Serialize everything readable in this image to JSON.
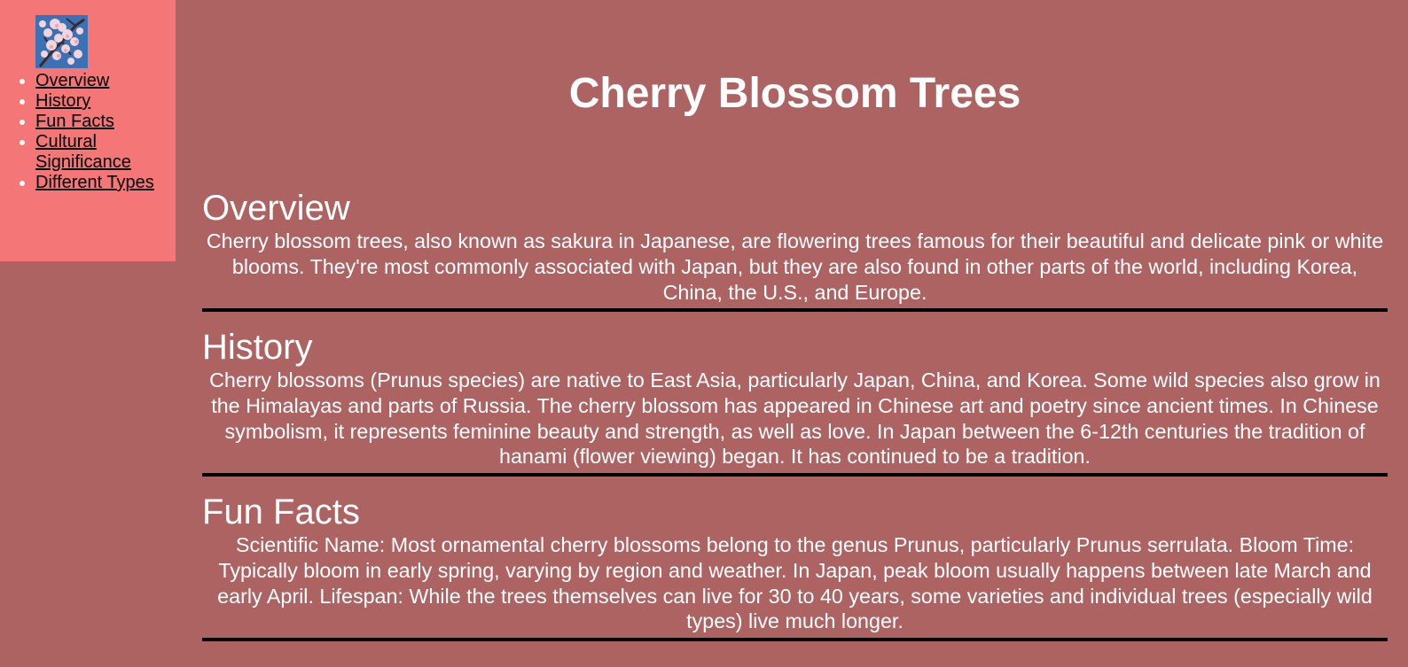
{
  "sidebar": {
    "logo_icon": "cherry-blossom-image",
    "items": [
      {
        "label": "Overview"
      },
      {
        "label": "History"
      },
      {
        "label": "Fun Facts"
      },
      {
        "label": "Cultural Significance"
      },
      {
        "label": "Different Types"
      }
    ]
  },
  "main": {
    "title": "Cherry Blossom Trees",
    "sections": [
      {
        "heading": "Overview",
        "body": "Cherry blossom trees, also known as sakura in Japanese, are flowering trees famous for their beautiful and delicate pink or white blooms. They're most commonly associated with Japan, but they are also found in other parts of the world, including Korea, China, the U.S., and Europe."
      },
      {
        "heading": "History",
        "body": "Cherry blossoms (Prunus species) are native to East Asia, particularly Japan, China, and Korea. Some wild species also grow in the Himalayas and parts of Russia. The cherry blossom has appeared in Chinese art and poetry since ancient times. In Chinese symbolism, it represents feminine beauty and strength, as well as love. In Japan between the 6-12th centuries the tradition of hanami (flower viewing) began. It has continued to be a tradition."
      },
      {
        "heading": "Fun Facts",
        "body": "Scientific Name: Most ornamental cherry blossoms belong to the genus Prunus, particularly Prunus serrulata. Bloom Time: Typically bloom in early spring, varying by region and weather. In Japan, peak bloom usually happens between late March and early April. Lifespan: While the trees themselves can live for 30 to 40 years, some varieties and individual trees (especially wild types) live much longer."
      }
    ]
  },
  "colors": {
    "page_background": "#ae6363",
    "sidebar_background": "#f47676",
    "text": "#ffffff",
    "link": "#000000",
    "rule": "#000000"
  }
}
